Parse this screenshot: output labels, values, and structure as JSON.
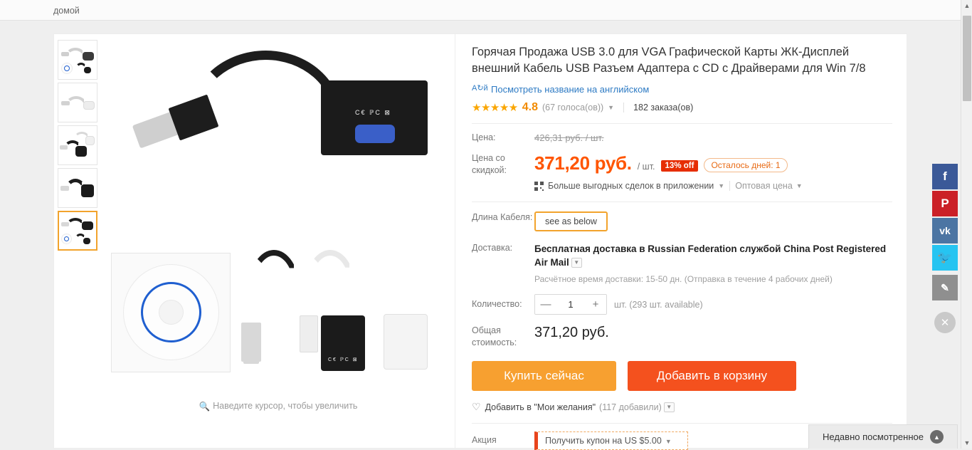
{
  "breadcrumb": {
    "home": "домой"
  },
  "gallery": {
    "thumbnails": [
      {
        "name": "white-adapter-with-cd-set",
        "selected": false
      },
      {
        "name": "white-adapter",
        "selected": false
      },
      {
        "name": "black-and-white-adapters",
        "selected": false
      },
      {
        "name": "black-adapter",
        "selected": false
      },
      {
        "name": "black-adapter-with-cd-set",
        "selected": true
      }
    ],
    "zoom_hint": "Наведите курсор, чтобы увеличить",
    "zoom_icon": "magnifier-icon"
  },
  "product": {
    "title": "Горячая Продажа USB 3.0 для VGA Графической Карты ЖК-Дисплей внешний Кабель USB Разъем Адаптера с CD с Драйверами для Win 7/8",
    "translate_link": "Посмотреть название на английском",
    "translate_icon": "translate-icon",
    "rating": {
      "stars": "★★★★★",
      "value": "4.8",
      "votes": "(67 голоса(ов))",
      "orders": "182 заказа(ов)"
    }
  },
  "price": {
    "label_original": "Цена:",
    "original": "426,31 руб. / шт.",
    "label_discount": "Цена со скидкой:",
    "discount": "371,20 руб.",
    "per_unit": "/ шт.",
    "off_badge": "13% off",
    "days_left": "Осталось дней: 1",
    "app_deals": "Больше выгодных сделок в приложении",
    "app_deals_icon": "qr-code-icon",
    "wholesale": "Оптовая цена"
  },
  "specs": {
    "cable_length_label": "Длина Кабеля:",
    "cable_length_value": "see as below"
  },
  "shipping": {
    "label": "Доставка:",
    "text": "Бесплатная доставка в Russian Federation службой China Post Registered Air Mail",
    "estimate": "Расчётное время доставки: 15-50 дн. (Отправка в течение 4 рабочих дней)"
  },
  "quantity": {
    "label": "Количество:",
    "value": "1",
    "minus": "—",
    "plus": "+",
    "availability": "шт. (293 шт. available)"
  },
  "total": {
    "label": "Общая стоимость:",
    "value": "371,20 руб."
  },
  "actions": {
    "buy_now": "Купить сейчас",
    "add_to_cart": "Добавить в корзину",
    "wishlist": "Добавить в \"Мои желания\"",
    "wishlist_count": "(117 добавили)",
    "wishlist_icon": "heart-plus-icon"
  },
  "promo": {
    "label": "Акция",
    "coupon": "Получить купон на US $5.00"
  },
  "social": [
    {
      "name": "facebook",
      "glyph": "f"
    },
    {
      "name": "pinterest",
      "glyph": "P"
    },
    {
      "name": "vk",
      "glyph": "vk"
    },
    {
      "name": "twitter",
      "glyph": "🐦"
    },
    {
      "name": "edit",
      "glyph": "✎"
    },
    {
      "name": "close",
      "glyph": "✕"
    }
  ],
  "recent": {
    "label": "Недавно посмотренное",
    "arrow_icon": "chevron-up-icon"
  },
  "colors": {
    "accent_orange": "#ff5500",
    "buy_button": "#f7a030",
    "cart_button": "#f4511e",
    "badge_red": "#e62e04",
    "link_blue": "#2e7bc4",
    "star_gold": "#faa603"
  }
}
